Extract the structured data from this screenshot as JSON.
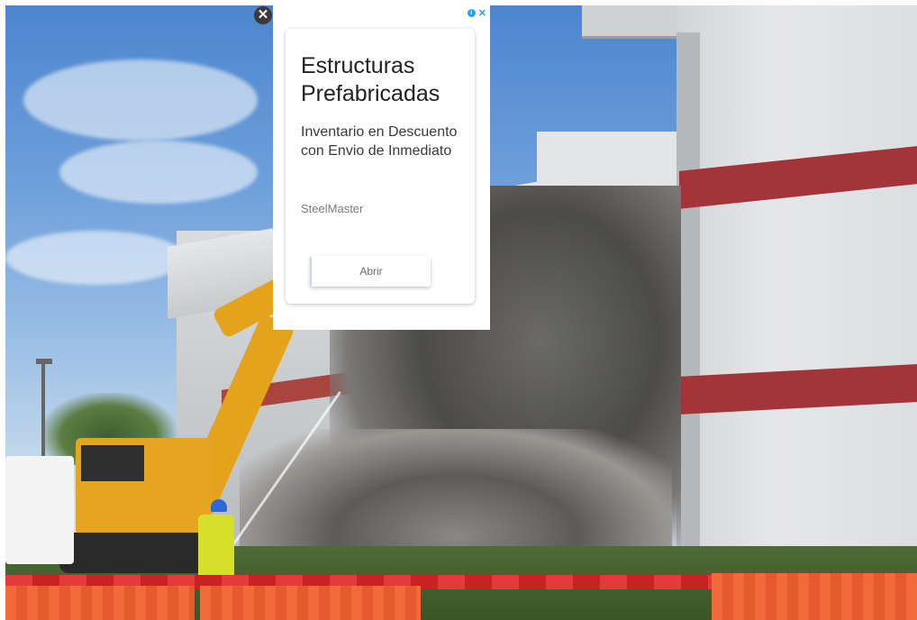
{
  "ad": {
    "title": "Estructuras Prefabricadas",
    "description": "Inventario en Descuento con Envio de Inmediato",
    "advertiser": "SteelMaster",
    "cta_label": "Abrir",
    "close_glyph": "✕",
    "adchoices_icon": "info-icon",
    "accent_color": "#24a3e0"
  },
  "overlay": {
    "close_icon": "close-icon",
    "close_glyph": "✕"
  },
  "photo": {
    "subject": "excavator-demolishing-building"
  }
}
